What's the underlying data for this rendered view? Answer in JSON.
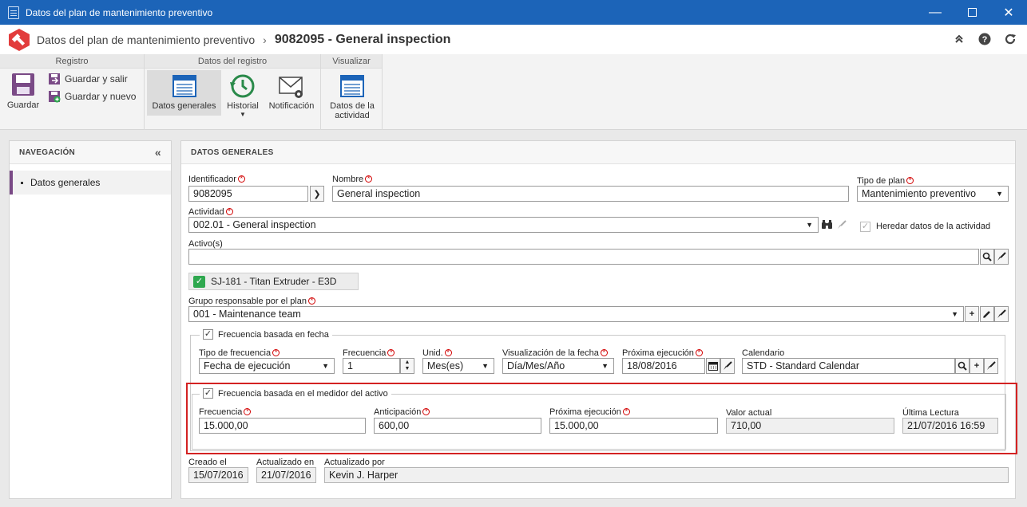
{
  "window": {
    "title": "Datos del plan de mantenimiento preventivo"
  },
  "header": {
    "parent": "Datos del plan de mantenimiento preventivo",
    "current": "9082095 - General inspection"
  },
  "ribbon": {
    "groups": [
      "Registro",
      "Datos del registro",
      "Visualizar"
    ],
    "save": "Guardar",
    "save_exit": "Guardar y salir",
    "save_new": "Guardar y nuevo",
    "general_data": "Datos generales",
    "history": "Historial",
    "notification": "Notificación",
    "activity_data": "Datos de la actividad"
  },
  "nav": {
    "title": "NAVEGACIÓN",
    "items": [
      "Datos generales"
    ]
  },
  "main": {
    "title": "DATOS GENERALES"
  },
  "form": {
    "identificador_label": "Identificador",
    "identificador": "9082095",
    "nombre_label": "Nombre",
    "nombre": "General inspection",
    "tipo_plan_label": "Tipo de plan",
    "tipo_plan": "Mantenimiento preventivo",
    "actividad_label": "Actividad",
    "actividad": "002.01 - General inspection",
    "heredar_label": "Heredar datos de la actividad",
    "activos_label": "Activo(s)",
    "activos": "",
    "asset_tag": "SJ-181 - Titan Extruder - E3D",
    "grupo_label": "Grupo responsable por el plan",
    "grupo": "001 - Maintenance team",
    "fecha_section": "Frecuencia basada en fecha",
    "tipo_frec_label": "Tipo de frecuencia",
    "tipo_frec": "Fecha de ejecución",
    "frec_label": "Frecuencia",
    "frec": "1",
    "unid_label": "Unid.",
    "unid": "Mes(es)",
    "visual_label": "Visualización de la fecha",
    "visual": "Día/Mes/Año",
    "prox_label": "Próxima ejecución",
    "prox": "18/08/2016",
    "calendario_label": "Calendario",
    "calendario": "STD - Standard Calendar",
    "medidor_section": "Frecuencia basada en el medidor del activo",
    "m_frec_label": "Frecuencia",
    "m_frec": "15.000,00",
    "m_antic_label": "Anticipación",
    "m_antic": "600,00",
    "m_prox_label": "Próxima ejecución",
    "m_prox": "15.000,00",
    "m_valor_label": "Valor actual",
    "m_valor": "710,00",
    "m_ultima_label": "Última Lectura",
    "m_ultima": "21/07/2016 16:59",
    "creado_label": "Creado el",
    "creado": "15/07/2016",
    "actualizado_label": "Actualizado en",
    "actualizado": "21/07/2016",
    "actualizado_por_label": "Actualizado por",
    "actualizado_por": "Kevin J. Harper"
  },
  "colors": {
    "titlebar": "#1c64b8",
    "accent": "#7a4a86",
    "highlight": "#d32222"
  }
}
